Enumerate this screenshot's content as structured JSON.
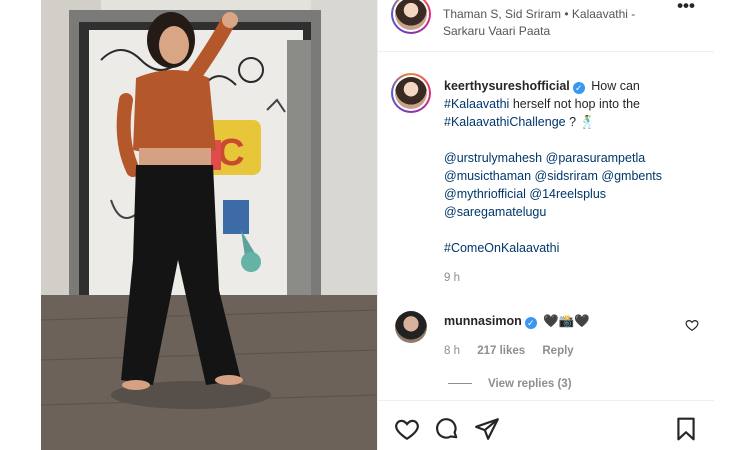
{
  "song": {
    "title_line1": "Thaman S, Sid Sriram • Kalaavathi -",
    "title_line2": "Sarkaru Vaari Paata",
    "more_icon": "more-horizontal-icon"
  },
  "caption": {
    "username": "keerthysureshofficial",
    "verified_icon": "verified-badge-icon",
    "text_a": "How can",
    "tag_kalaavathi": "#Kalaavathi",
    "text_b": "herself not hop into the",
    "tag_challenge": "#KalaavathiChallenge",
    "text_c": "? 🕺",
    "mentions": [
      [
        "@urstrulymahesh",
        "@parasurampetla"
      ],
      [
        "@musicthaman",
        "@sidsriram",
        "@gmbents"
      ],
      [
        "@mythriofficial",
        "@14reelsplus"
      ],
      [
        "@saregamatelugu"
      ]
    ],
    "closing_tag": "#ComeOnKalaavathi",
    "time": "9 h"
  },
  "comment": {
    "username": "munnasimon",
    "text": "🖤📸🖤",
    "time": "8 h",
    "likes": "217 likes",
    "reply_label": "Reply",
    "view_replies": "View replies (3)"
  },
  "actions": {
    "like_icon": "heart-icon",
    "comment_icon": "comment-icon",
    "share_icon": "paper-plane-icon",
    "save_icon": "bookmark-icon"
  },
  "colors": {
    "link": "#00376b",
    "muted": "#8e8e8e",
    "verified": "#3897f0"
  }
}
